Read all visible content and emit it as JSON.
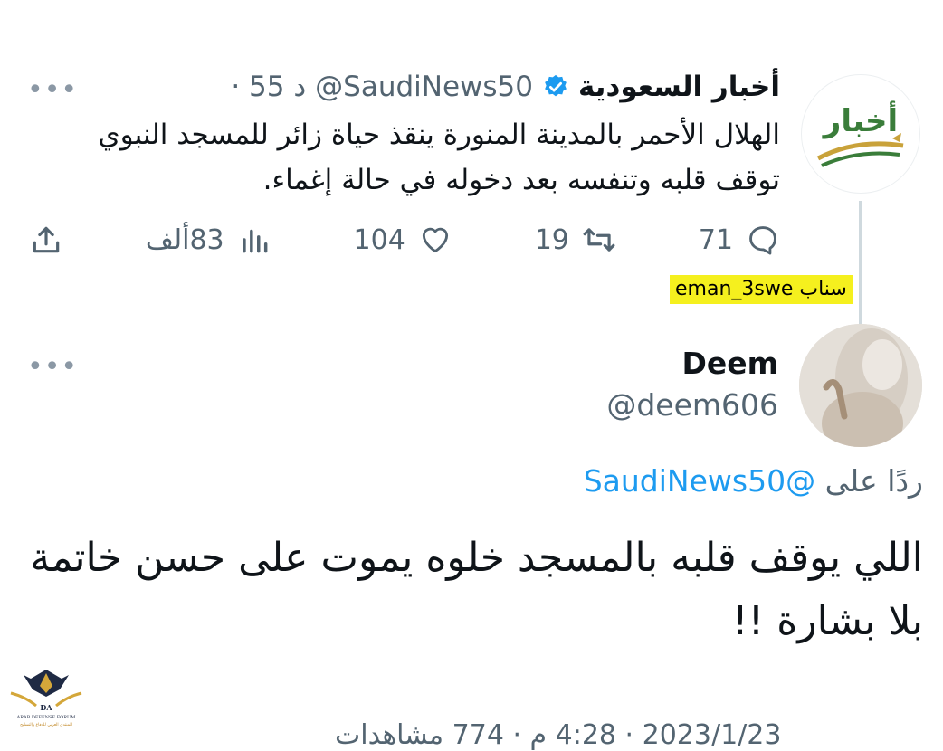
{
  "tweet": {
    "display_name": "أخبار السعودية",
    "handle": "@SaudiNews50",
    "time": "· 55 د",
    "more": "•••",
    "text": "الهلال الأحمر بالمدينة المنورة ينقذ حياة زائر للمسجد النبوي توقف قلبه وتنفسه بعد دخوله في حالة إغماء.",
    "avatar_brand": "أخبار",
    "actions": {
      "reply_count": "71",
      "retweet_count": "19",
      "like_count": "104",
      "views_count": "83ألف"
    },
    "icons": [
      "verified-badge-icon",
      "reply-icon",
      "retweet-icon",
      "like-icon",
      "views-icon",
      "share-icon"
    ]
  },
  "overlay": {
    "snap_label": "سناب eman_3swe"
  },
  "reply": {
    "display_name": "Deem",
    "handle": "@deem606",
    "more": "•••",
    "replying_prefix": "ردًا على",
    "replying_to": "@SaudiNews50",
    "text": "اللي يوقف قلبه بالمسجد خلوه يموت على حسن خاتمة بلا بشارة !!",
    "footer_partial": "2023/1/23 · 4:28 م · 774 مشاهدات"
  },
  "watermark": {
    "label": "ARAB DEFENSE FORUM",
    "sub": "المنتدى العربي للدفاع والتسليح"
  },
  "colors": {
    "verified": "#1d9bf0",
    "mention": "#1d9bf0",
    "secondary_text": "#536471",
    "snap_highlight": "#f5f01e",
    "brand_green": "#3a7d3a",
    "brand_gold": "#c9a23a"
  }
}
